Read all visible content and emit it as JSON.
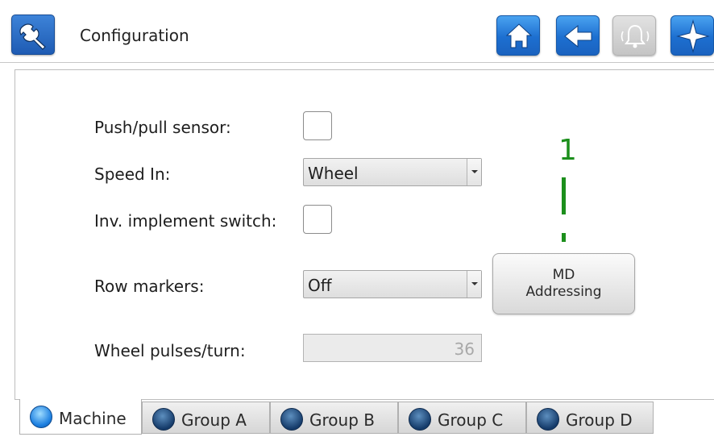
{
  "header": {
    "title": "Configuration",
    "app_icon": "wrench-icon",
    "buttons": [
      {
        "name": "home",
        "icon": "home-icon",
        "enabled": true
      },
      {
        "name": "back",
        "icon": "back-arrow-icon",
        "enabled": true
      },
      {
        "name": "alarm",
        "icon": "bell-icon",
        "enabled": false
      },
      {
        "name": "navigation",
        "icon": "compass-icon",
        "enabled": true
      }
    ]
  },
  "form": {
    "push_pull_label": "Push/pull sensor:",
    "push_pull_checked": false,
    "speed_in_label": "Speed In:",
    "speed_in_value": "Wheel",
    "inv_switch_label": "Inv. implement switch:",
    "inv_switch_checked": false,
    "row_markers_label": "Row markers:",
    "row_markers_value": "Off",
    "wheel_pulses_label": "Wheel pulses/turn:",
    "wheel_pulses_value": "36"
  },
  "md_button": {
    "line1": "MD",
    "line2": "Addressing"
  },
  "callout": {
    "number": "1",
    "color": "#1c8f1c"
  },
  "tabs": [
    {
      "label": "Machine",
      "active": true
    },
    {
      "label": "Group A",
      "active": false
    },
    {
      "label": "Group B",
      "active": false
    },
    {
      "label": "Group C",
      "active": false
    },
    {
      "label": "Group D",
      "active": false
    }
  ],
  "colors": {
    "accent_blue": "#1d6fd0",
    "disabled_gray": "#c4c4c4"
  }
}
